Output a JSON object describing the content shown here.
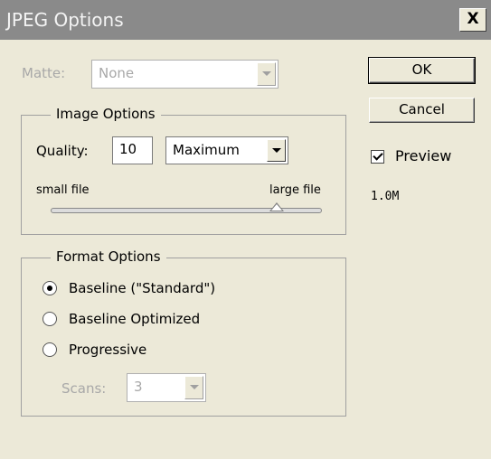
{
  "dialog": {
    "title": "JPEG Options",
    "close_glyph": "X"
  },
  "matte": {
    "label": "Matte:",
    "value": "None"
  },
  "image_options": {
    "legend": "Image Options",
    "quality_label": "Quality:",
    "quality_value": "10",
    "quality_preset": "Maximum",
    "slider_left_label": "small file",
    "slider_right_label": "large file",
    "slider_level": 0.833
  },
  "format_options": {
    "legend": "Format Options",
    "radios": [
      {
        "label": "Baseline (\"Standard\")",
        "selected": true
      },
      {
        "label": "Baseline Optimized",
        "selected": false
      },
      {
        "label": "Progressive",
        "selected": false
      }
    ],
    "scans_label": "Scans:",
    "scans_value": "3"
  },
  "buttons": {
    "ok": "OK",
    "cancel": "Cancel"
  },
  "preview": {
    "label": "Preview",
    "checked": true
  },
  "file_size": "1.0M",
  "icons": {
    "close": "close-icon",
    "dropdown": "chevron-down-icon",
    "check": "checkmark-icon"
  }
}
